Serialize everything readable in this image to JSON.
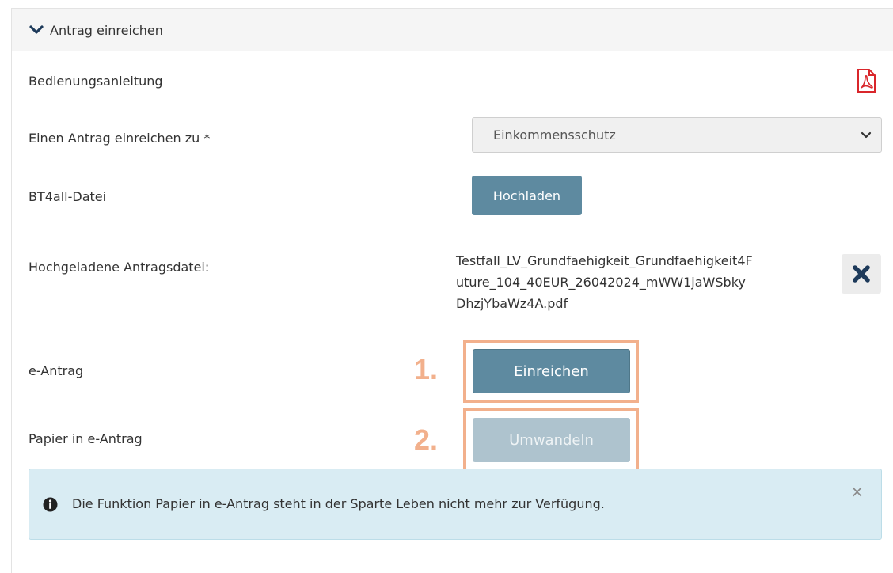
{
  "section": {
    "title": "Antrag einreichen"
  },
  "manual": {
    "label": "Bedienungsanleitung",
    "icon": "pdf-icon"
  },
  "application_type": {
    "label": "Einen Antrag einreichen zu *",
    "selected": "Einkommensschutz"
  },
  "bt4all": {
    "label": "BT4all-Datei",
    "upload_label": "Hochladen"
  },
  "uploaded_file": {
    "label": "Hochgeladene Antragsdatei:",
    "name_lines": [
      "Testfall_LV_Grundfaehigkeit_Grundfaehigkeit4F",
      "uture_104_40EUR_26042024_mWW1jaWSbky",
      "DhzjYbaWz4A.pdf"
    ]
  },
  "e_antrag": {
    "label": "e-Antrag",
    "button_label": "Einreichen",
    "step": "1."
  },
  "paper_convert": {
    "label": "Papier in e-Antrag",
    "button_label": "Umwandeln",
    "step": "2.",
    "disabled": true
  },
  "alert": {
    "message": "Die Funktion Papier in e-Antrag steht in der Sparte Leben nicht mehr zur Verfügung.",
    "close_symbol": "×"
  },
  "colors": {
    "primary_button": "#5e8aa0",
    "disabled_button": "#aec3ce",
    "highlight": "#f2b08c",
    "alert_bg": "#d9ecf3",
    "pdf_red": "#d9262b"
  }
}
